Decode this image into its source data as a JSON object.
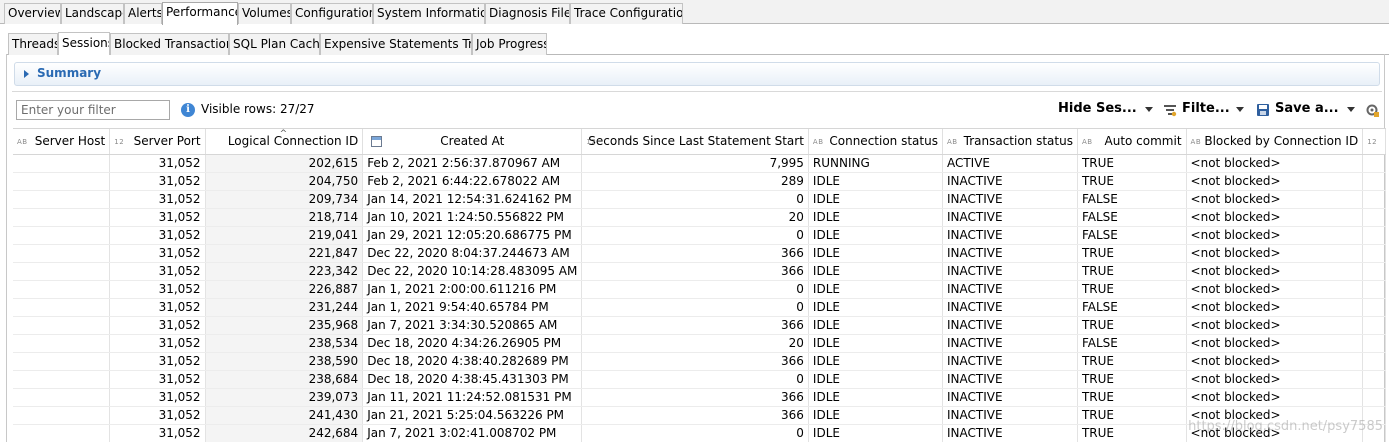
{
  "main_tabs": [
    {
      "label": "Overview",
      "active": false
    },
    {
      "label": "Landscape",
      "active": false
    },
    {
      "label": "Alerts",
      "active": false
    },
    {
      "label": "Performance",
      "active": true
    },
    {
      "label": "Volumes",
      "active": false
    },
    {
      "label": "Configuration",
      "active": false
    },
    {
      "label": "System Information",
      "active": false
    },
    {
      "label": "Diagnosis Files",
      "active": false
    },
    {
      "label": "Trace Configuration",
      "active": false
    }
  ],
  "sub_tabs": [
    {
      "label": "Threads",
      "active": false
    },
    {
      "label": "Sessions",
      "active": true
    },
    {
      "label": "Blocked Transactions",
      "active": false
    },
    {
      "label": "SQL Plan Cache",
      "active": false
    },
    {
      "label": "Expensive Statements Trace",
      "active": false
    },
    {
      "label": "Job Progress",
      "active": false
    }
  ],
  "summary": {
    "label": "Summary"
  },
  "filter": {
    "placeholder": "Enter your filter",
    "value": ""
  },
  "visible_rows": "Visible rows: 27/27",
  "toolbar": {
    "hide_sessions": "Hide Ses...",
    "filter": "Filte...",
    "save": "Save a..."
  },
  "table": {
    "columns": [
      {
        "label": "Server Host",
        "type": "AB"
      },
      {
        "label": "Server Port",
        "type": "12"
      },
      {
        "label": "Logical Connection ID",
        "type": ""
      },
      {
        "label": "Created At",
        "type": "cal"
      },
      {
        "label": "Seconds Since Last Statement Start",
        "type": "12"
      },
      {
        "label": "Connection status",
        "type": "AB"
      },
      {
        "label": "Transaction status",
        "type": "AB"
      },
      {
        "label": "Auto commit",
        "type": "AB"
      },
      {
        "label": "Blocked by Connection ID",
        "type": "AB"
      },
      {
        "label": "",
        "type": "12"
      }
    ],
    "rows": [
      [
        "",
        "31,052",
        "202,615",
        "Feb 2, 2021 2:56:37.870967 AM",
        "7,995",
        "RUNNING",
        "ACTIVE",
        "TRUE",
        "<not blocked>"
      ],
      [
        "",
        "31,052",
        "204,750",
        "Feb 2, 2021 6:44:22.678022 AM",
        "289",
        "IDLE",
        "INACTIVE",
        "TRUE",
        "<not blocked>"
      ],
      [
        "",
        "31,052",
        "209,734",
        "Jan 14, 2021 12:54:31.624162 PM",
        "0",
        "IDLE",
        "INACTIVE",
        "FALSE",
        "<not blocked>"
      ],
      [
        "",
        "31,052",
        "218,714",
        "Jan 10, 2021 1:24:50.556822 PM",
        "20",
        "IDLE",
        "INACTIVE",
        "FALSE",
        "<not blocked>"
      ],
      [
        "",
        "31,052",
        "219,041",
        "Jan 29, 2021 12:05:20.686775 PM",
        "0",
        "IDLE",
        "INACTIVE",
        "FALSE",
        "<not blocked>"
      ],
      [
        "",
        "31,052",
        "221,847",
        "Dec 22, 2020 8:04:37.244673 AM",
        "366",
        "IDLE",
        "INACTIVE",
        "TRUE",
        "<not blocked>"
      ],
      [
        "",
        "31,052",
        "223,342",
        "Dec 22, 2020 10:14:28.483095 AM",
        "366",
        "IDLE",
        "INACTIVE",
        "TRUE",
        "<not blocked>"
      ],
      [
        "",
        "31,052",
        "226,887",
        "Jan 1, 2021 2:00:00.611216 PM",
        "0",
        "IDLE",
        "INACTIVE",
        "TRUE",
        "<not blocked>"
      ],
      [
        "",
        "31,052",
        "231,244",
        "Jan 1, 2021 9:54:40.65784 PM",
        "0",
        "IDLE",
        "INACTIVE",
        "FALSE",
        "<not blocked>"
      ],
      [
        "",
        "31,052",
        "235,968",
        "Jan 7, 2021 3:34:30.520865 AM",
        "366",
        "IDLE",
        "INACTIVE",
        "TRUE",
        "<not blocked>"
      ],
      [
        "",
        "31,052",
        "238,534",
        "Dec 18, 2020 4:34:26.26905 PM",
        "20",
        "IDLE",
        "INACTIVE",
        "FALSE",
        "<not blocked>"
      ],
      [
        "",
        "31,052",
        "238,590",
        "Dec 18, 2020 4:38:40.282689 PM",
        "366",
        "IDLE",
        "INACTIVE",
        "TRUE",
        "<not blocked>"
      ],
      [
        "",
        "31,052",
        "238,684",
        "Dec 18, 2020 4:38:45.431303 PM",
        "0",
        "IDLE",
        "INACTIVE",
        "TRUE",
        "<not blocked>"
      ],
      [
        "",
        "31,052",
        "239,073",
        "Jan 11, 2021 11:24:52.081531 PM",
        "366",
        "IDLE",
        "INACTIVE",
        "TRUE",
        "<not blocked>"
      ],
      [
        "",
        "31,052",
        "241,430",
        "Jan 21, 2021 5:25:04.563226 PM",
        "366",
        "IDLE",
        "INACTIVE",
        "TRUE",
        "<not blocked>"
      ],
      [
        "",
        "31,052",
        "242,684",
        "Jan 7, 2021 3:02:41.008702 PM",
        "0",
        "IDLE",
        "INACTIVE",
        "TRUE",
        "<not blocked>"
      ]
    ]
  },
  "watermark": "https://blog.csdn.net/psy7585"
}
